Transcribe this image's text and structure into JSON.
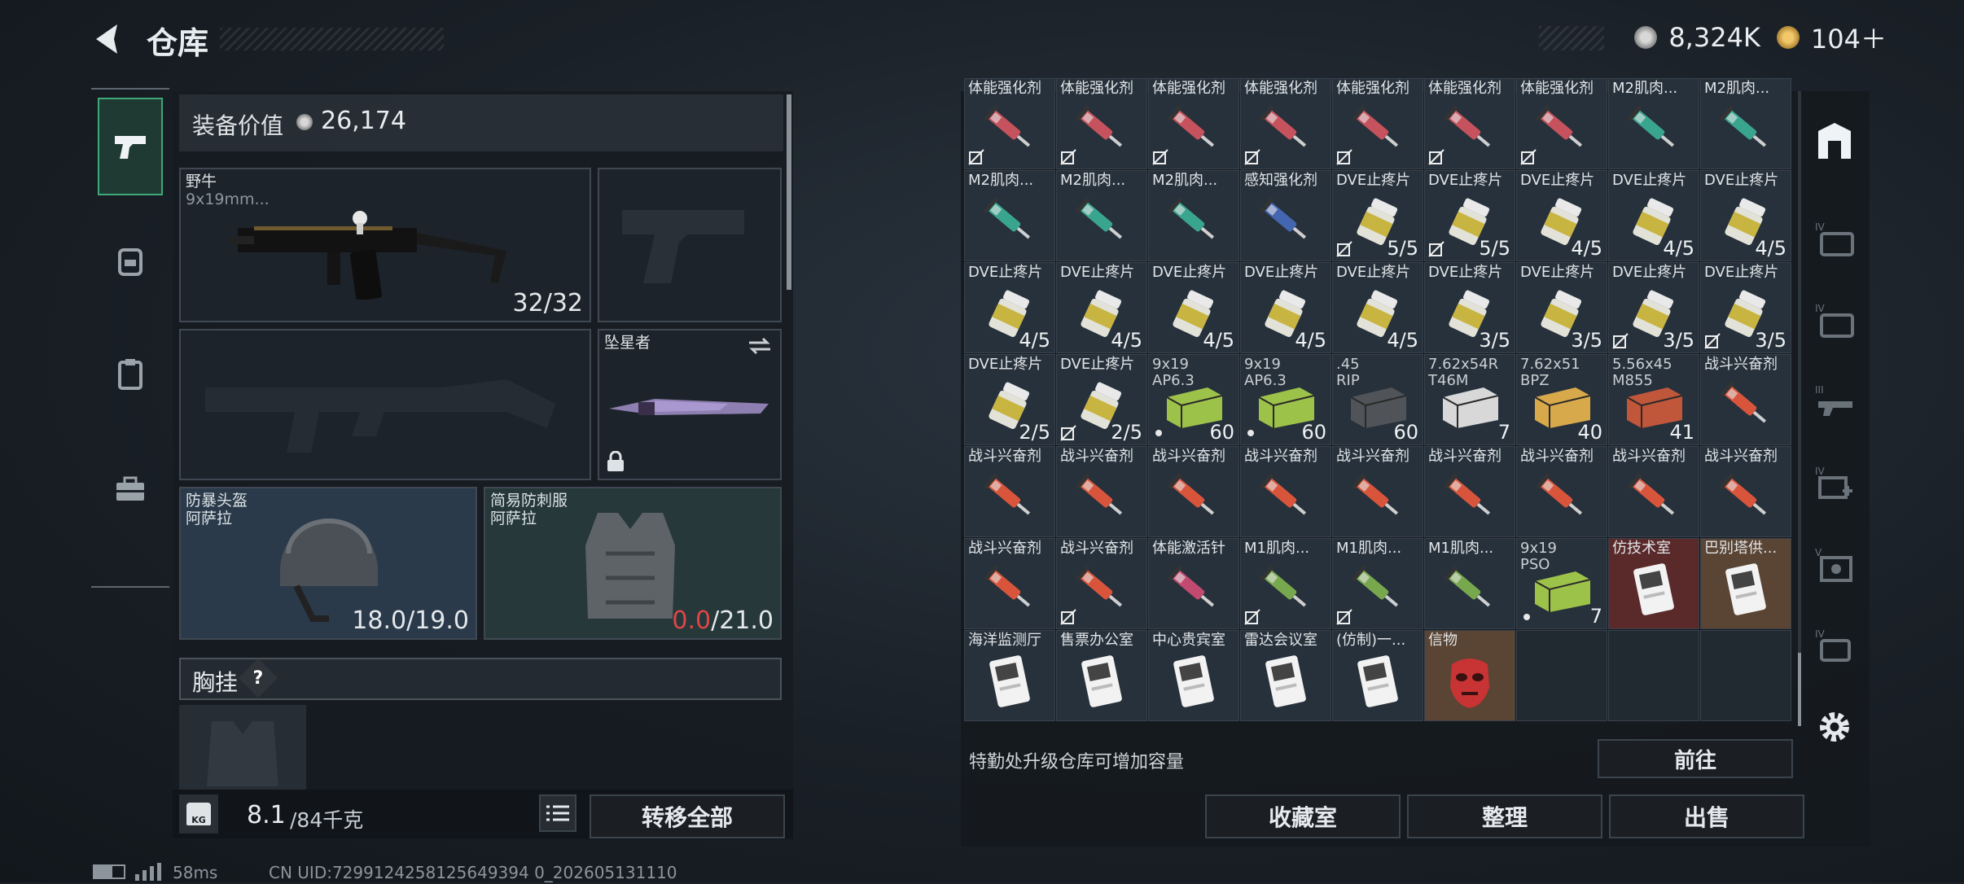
{
  "header": {
    "title": "仓库",
    "currency1": "8,324K",
    "currency2": "104＋"
  },
  "equipment": {
    "value_label": "装备价值",
    "value": "26,174",
    "primary": {
      "name": "野牛",
      "caliber": "9x19mm...",
      "ammo": "32/32"
    },
    "melee": {
      "name": "坠星者"
    },
    "helmet": {
      "name": "防暴头盔",
      "map": "阿萨拉",
      "durability": "18.0/19.0"
    },
    "armor": {
      "name": "简易防刺服",
      "map": "阿萨拉",
      "durability_current": "0.0",
      "durability_max": "/21.0"
    },
    "chest_label": "胸挂",
    "chest_help": "?",
    "weight": "8.1",
    "weight_max": "/84千克",
    "weight_icon": "KG",
    "transfer_all": "转移全部"
  },
  "stash": {
    "upgrade_text": "特勤处升级仓库可增加容量",
    "goto_button": "前往",
    "buttons": [
      "收藏室",
      "整理",
      "出售"
    ]
  },
  "grid_rows": [
    [
      {
        "l": "体能强化剂",
        "t": "syr-red",
        "ns": true
      },
      {
        "l": "体能强化剂",
        "t": "syr-red",
        "ns": true
      },
      {
        "l": "体能强化剂",
        "t": "syr-red",
        "ns": true
      },
      {
        "l": "体能强化剂",
        "t": "syr-red",
        "ns": true
      },
      {
        "l": "体能强化剂",
        "t": "syr-red",
        "ns": true
      },
      {
        "l": "体能强化剂",
        "t": "syr-red",
        "ns": true
      },
      {
        "l": "体能强化剂",
        "t": "syr-red",
        "ns": true
      },
      {
        "l": "M2肌肉...",
        "t": "syr-teal"
      },
      {
        "l": "M2肌肉...",
        "t": "syr-teal"
      }
    ],
    [
      {
        "l": "M2肌肉...",
        "t": "syr-teal"
      },
      {
        "l": "M2肌肉...",
        "t": "syr-teal"
      },
      {
        "l": "M2肌肉...",
        "t": "syr-teal"
      },
      {
        "l": "感知强化剂",
        "t": "syr-blue"
      },
      {
        "l": "DVE止疼片",
        "t": "pill",
        "q": "5/5",
        "ns": true
      },
      {
        "l": "DVE止疼片",
        "t": "pill",
        "q": "5/5",
        "ns": true
      },
      {
        "l": "DVE止疼片",
        "t": "pill",
        "q": "4/5"
      },
      {
        "l": "DVE止疼片",
        "t": "pill",
        "q": "4/5"
      },
      {
        "l": "DVE止疼片",
        "t": "pill",
        "q": "4/5"
      }
    ],
    [
      {
        "l": "DVE止疼片",
        "t": "pill",
        "q": "4/5"
      },
      {
        "l": "DVE止疼片",
        "t": "pill",
        "q": "4/5"
      },
      {
        "l": "DVE止疼片",
        "t": "pill",
        "q": "4/5"
      },
      {
        "l": "DVE止疼片",
        "t": "pill",
        "q": "4/5"
      },
      {
        "l": "DVE止疼片",
        "t": "pill",
        "q": "4/5"
      },
      {
        "l": "DVE止疼片",
        "t": "pill",
        "q": "3/5"
      },
      {
        "l": "DVE止疼片",
        "t": "pill",
        "q": "3/5"
      },
      {
        "l": "DVE止疼片",
        "t": "pill",
        "q": "3/5",
        "ns": true
      },
      {
        "l": "DVE止疼片",
        "t": "pill",
        "q": "3/5",
        "ns": true
      }
    ],
    [
      {
        "l": "DVE止疼片",
        "t": "pill",
        "q": "2/5"
      },
      {
        "l": "DVE止疼片",
        "t": "pill",
        "q": "2/5",
        "ns": true
      },
      {
        "l": "9x19\nAP6.3",
        "t": "ammo-green",
        "q": "60",
        "dot": true
      },
      {
        "l": "9x19\nAP6.3",
        "t": "ammo-green",
        "q": "60",
        "dot": true
      },
      {
        "l": ".45\nRIP",
        "t": "ammo-gray",
        "q": "60"
      },
      {
        "l": "7.62x54R\nT46M",
        "t": "ammo-white",
        "q": "7"
      },
      {
        "l": "7.62x51\nBPZ",
        "t": "ammo-gold",
        "q": "40"
      },
      {
        "l": "5.56x45\nM855",
        "t": "ammo-red",
        "q": "41"
      },
      {
        "l": "战斗兴奋剂",
        "t": "syr-orange"
      }
    ],
    [
      {
        "l": "战斗兴奋剂",
        "t": "syr-orange"
      },
      {
        "l": "战斗兴奋剂",
        "t": "syr-orange"
      },
      {
        "l": "战斗兴奋剂",
        "t": "syr-orange"
      },
      {
        "l": "战斗兴奋剂",
        "t": "syr-orange"
      },
      {
        "l": "战斗兴奋剂",
        "t": "syr-orange"
      },
      {
        "l": "战斗兴奋剂",
        "t": "syr-orange"
      },
      {
        "l": "战斗兴奋剂",
        "t": "syr-orange"
      },
      {
        "l": "战斗兴奋剂",
        "t": "syr-orange"
      },
      {
        "l": "战斗兴奋剂",
        "t": "syr-orange"
      }
    ],
    [
      {
        "l": "战斗兴奋剂",
        "t": "syr-orange"
      },
      {
        "l": "战斗兴奋剂",
        "t": "syr-orange",
        "ns": true
      },
      {
        "l": "体能激活针",
        "t": "syr-pink"
      },
      {
        "l": "M1肌肉...",
        "t": "syr-green",
        "ns": true
      },
      {
        "l": "M1肌肉...",
        "t": "syr-green",
        "ns": true
      },
      {
        "l": "M1肌肉...",
        "t": "syr-green"
      },
      {
        "l": "9x19\nPSO",
        "t": "ammo-green",
        "q": "7",
        "dot": true
      },
      {
        "l": "仿技术室",
        "t": "card",
        "bg": "red"
      },
      {
        "l": "巴别塔供...",
        "t": "card",
        "bg": "gold"
      }
    ],
    [
      {
        "l": "海洋监测厅",
        "t": "card"
      },
      {
        "l": "售票办公室",
        "t": "card"
      },
      {
        "l": "中心贵宾室",
        "t": "card"
      },
      {
        "l": "雷达会议室",
        "t": "card"
      },
      {
        "l": "(仿制)一...",
        "t": "card"
      },
      {
        "l": "信物",
        "t": "mask",
        "bg": "gold"
      },
      {
        "l": "",
        "t": "empty"
      },
      {
        "l": "",
        "t": "empty"
      },
      {
        "l": "",
        "t": "empty"
      }
    ]
  ],
  "footer": {
    "ping": "58ms",
    "uid": "CN UID:7299124258125649394 0_202605131110"
  },
  "colors": {
    "accent_green": "#3ea878",
    "danger_red": "#e14545"
  }
}
